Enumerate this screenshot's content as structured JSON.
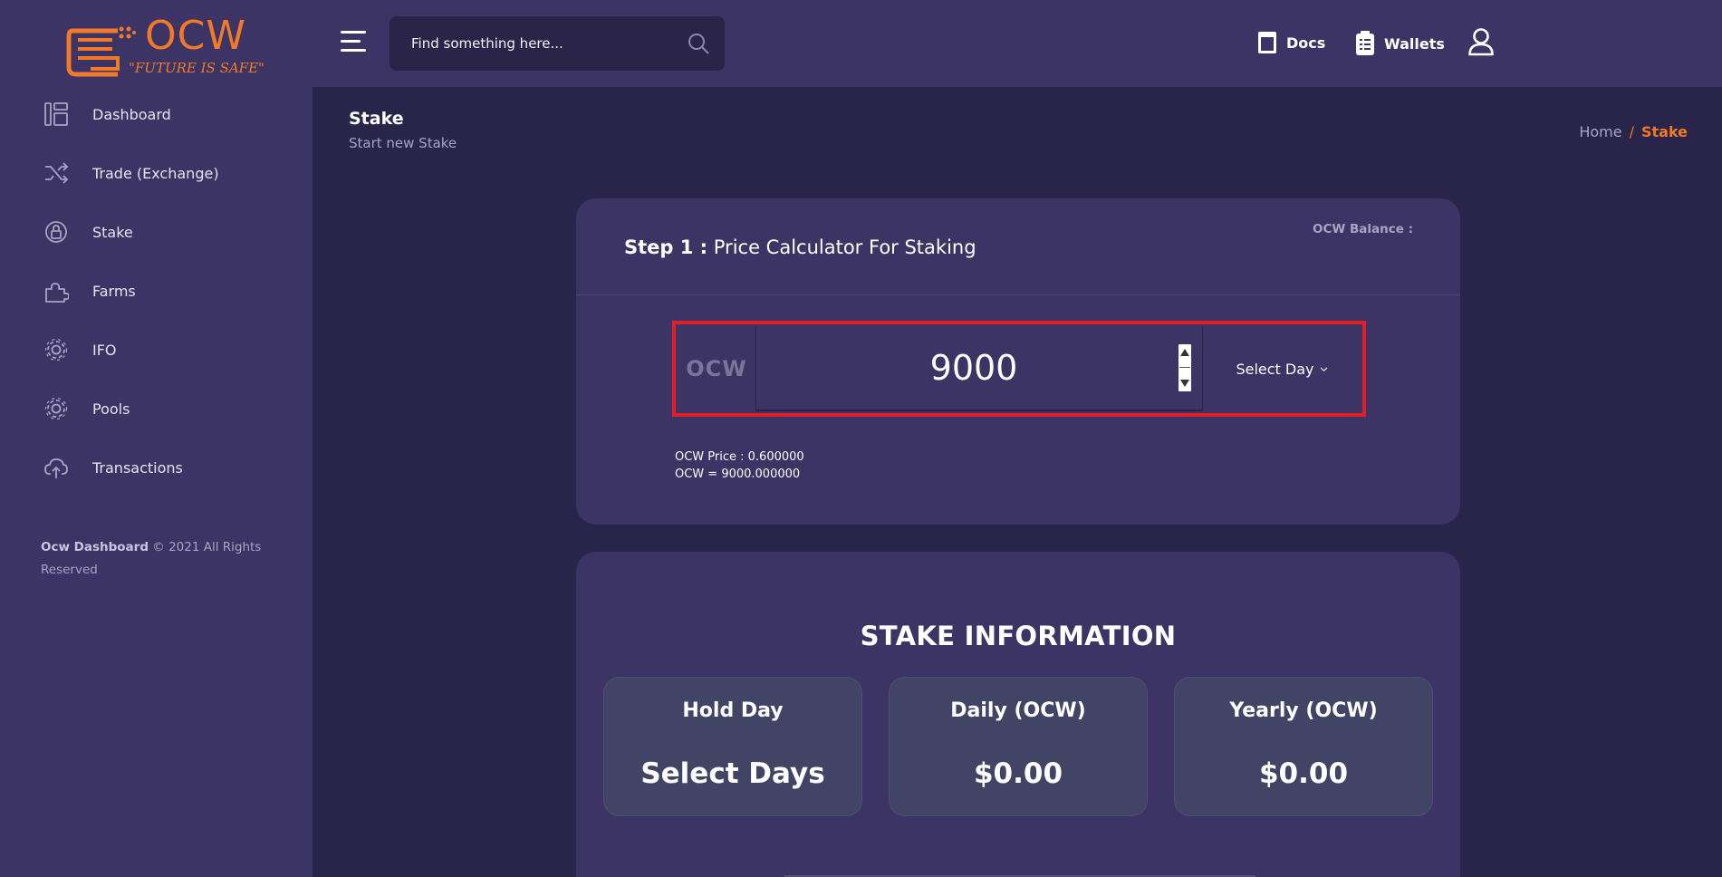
{
  "brand": {
    "logo_text": "OCW",
    "tagline": "\"FUTURE IS SAFE\"",
    "accent_color": "#f07a28"
  },
  "header": {
    "search_placeholder": "Find something here...",
    "docs_label": "Docs",
    "wallets_label": "Wallets"
  },
  "sidebar": {
    "items": [
      {
        "label": "Dashboard",
        "icon": "dashboard-icon"
      },
      {
        "label": "Trade (Exchange)",
        "icon": "shuffle-icon"
      },
      {
        "label": "Stake",
        "icon": "stake-lock-icon"
      },
      {
        "label": "Farms",
        "icon": "puzzle-icon"
      },
      {
        "label": "IFO",
        "icon": "gear-icon"
      },
      {
        "label": "Pools",
        "icon": "gear-icon"
      },
      {
        "label": "Transactions",
        "icon": "cloud-upload-icon"
      }
    ],
    "footer_brand": "Ocw Dashboard",
    "footer_text": "© 2021 All Rights Reserved"
  },
  "page": {
    "title": "Stake",
    "subtitle": "Start new Stake",
    "breadcrumb_home": "Home",
    "breadcrumb_sep": "/",
    "breadcrumb_current": "Stake"
  },
  "calculator": {
    "step_prefix": "Step 1 :",
    "step_title": "Price Calculator For Staking",
    "balance_label": "OCW Balance :",
    "currency_prefix": "OCW",
    "amount_value": "9000",
    "select_day_label": "Select Day",
    "price_line": "OCW Price : 0.600000",
    "equals_line": "OCW = 9000.000000",
    "highlight_color": "#e01f26"
  },
  "stake_info": {
    "heading": "STAKE INFORMATION",
    "boxes": [
      {
        "title": "Hold Day",
        "value": "Select Days"
      },
      {
        "title": "Daily (OCW)",
        "value": "$0.00"
      },
      {
        "title": "Yearly (OCW)",
        "value": "$0.00"
      }
    ]
  }
}
